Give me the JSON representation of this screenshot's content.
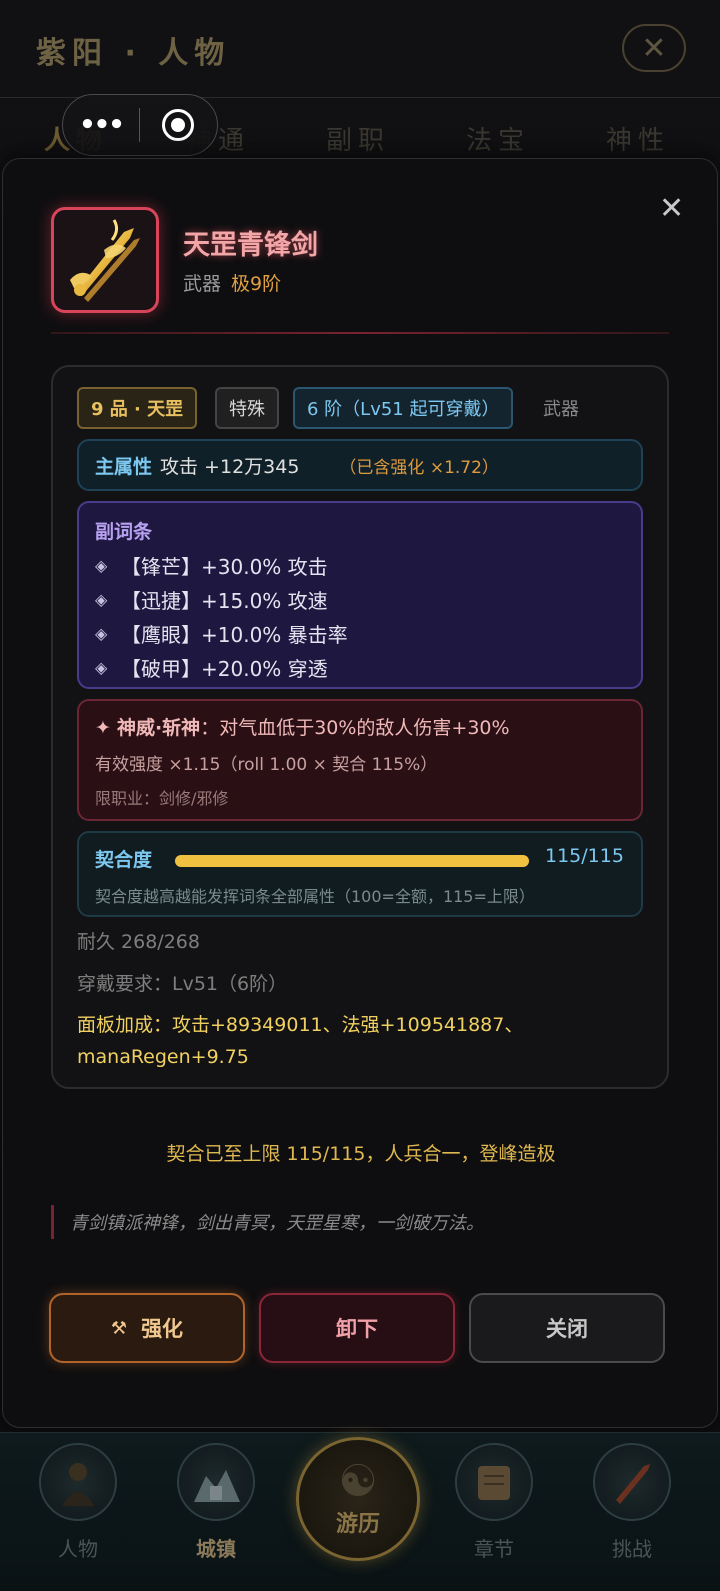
{
  "header": {
    "title": "紫阳 · 人物",
    "close_icon": "close-icon"
  },
  "tabs": [
    "人物",
    "神通",
    "副职",
    "法宝",
    "神性"
  ],
  "mini_program": {
    "more_icon": "more-dots-icon",
    "target_icon": "target-icon"
  },
  "item": {
    "name": "天罡青锋剑",
    "type": "武器",
    "tier": "极9阶",
    "icon": "sword-icon",
    "tags": {
      "grade": "9 品 · 天罡",
      "special": "特殊",
      "level": "6 阶（Lv51 起可穿戴）",
      "category": "武器"
    },
    "main_attr": {
      "label": "主属性",
      "value": "攻击 +12万345",
      "note": "（已含强化 ×1.72）"
    },
    "sub_attrs": {
      "title": "副词条",
      "lines": [
        "【锋芒】+30.0% 攻击",
        "【迅捷】+15.0% 攻速",
        "【鹰眼】+10.0% 暴击率",
        "【破甲】+20.0% 穿透"
      ]
    },
    "skill": {
      "name": "神威·斩神",
      "desc": "：对气血低于30%的敌人伤害+30%",
      "strength": "有效强度 ×1.15（roll 1.00 × 契合 115%）",
      "restrict": "限职业：剑修/邪修"
    },
    "bond": {
      "label": "契合度",
      "value_text": "115/115",
      "fill_fraction": 1.0,
      "desc": "契合度越高越能发挥词条全部属性（100=全额，115=上限）"
    },
    "durability": "耐久 268/268",
    "requirement": "穿戴要求：Lv51（6阶）",
    "panel_bonus": "面板加成：攻击+89349011、法强+109541887、manaRegen+9.75"
  },
  "limit_msg": "契合已至上限 115/115，人兵合一，登峰造极",
  "quote": "青剑镇派神锋，剑出青冥，天罡星寒，一剑破万法。",
  "buttons": {
    "enhance": "强化",
    "unequip": "卸下",
    "close": "关闭"
  },
  "bottom_nav": {
    "items": [
      "人物",
      "城镇",
      "游历",
      "章节",
      "挑战"
    ],
    "active": "城镇"
  },
  "colors": {
    "accent_gold": "#f0c040",
    "rare_red": "#d8455a",
    "info_blue": "#7cc8f0"
  }
}
